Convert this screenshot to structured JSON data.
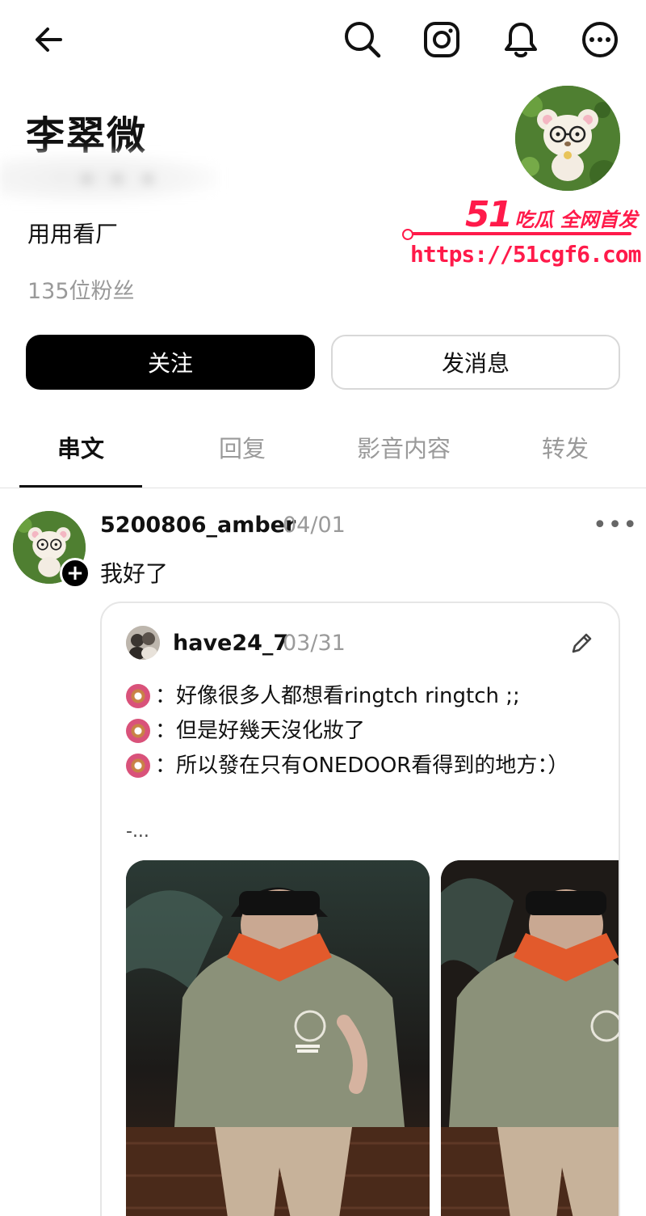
{
  "profile": {
    "name": "李翠微",
    "bio": "用用看厂",
    "followers": "135位粉丝"
  },
  "watermark": {
    "brand_number": "51",
    "brand_text": "吃瓜 全网首发",
    "url": "https://51cgf6.com"
  },
  "actions": {
    "follow_label": "关注",
    "message_label": "发消息"
  },
  "tabs": [
    {
      "label": "串文",
      "active": true
    },
    {
      "label": "回复",
      "active": false
    },
    {
      "label": "影音内容",
      "active": false
    },
    {
      "label": "转发",
      "active": false
    }
  ],
  "post": {
    "username": "5200806_amber",
    "date": "04/01",
    "text": "我好了",
    "quote": {
      "username": "have24_7",
      "date": "03/31",
      "lines": [
        "：好像很多人都想看ringtch ringtch ;;",
        "：但是好幾天沒化妝了",
        "：所以發在只有ONEDOOR看得到的地方：）"
      ],
      "truncation": "-..."
    }
  },
  "colors": {
    "watermark": "#ff1a4a",
    "muted_text": "#999999",
    "follow_bg": "#000000"
  }
}
